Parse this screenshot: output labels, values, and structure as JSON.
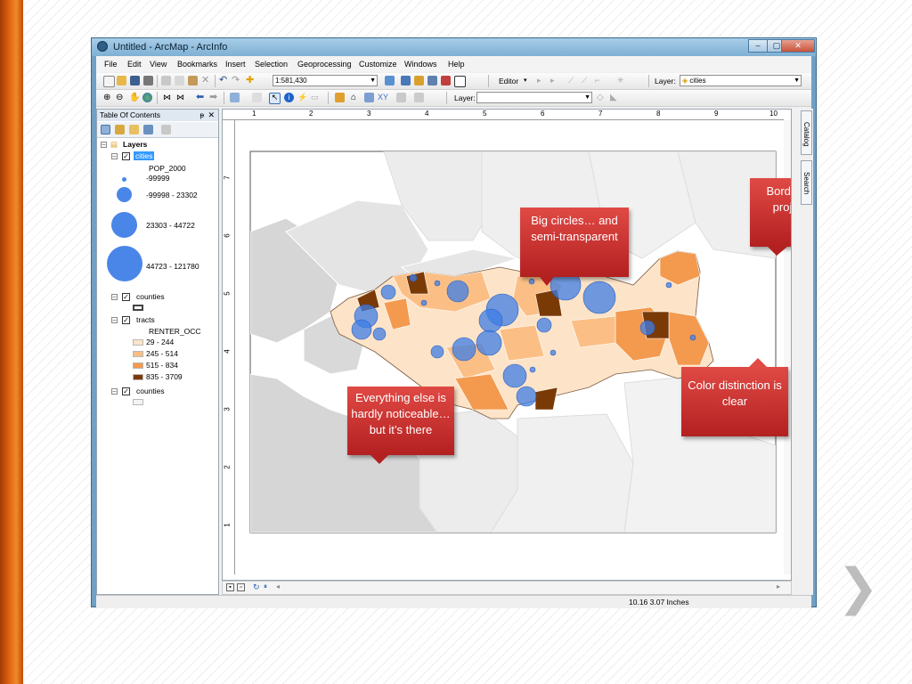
{
  "window": {
    "title": "Untitled - ArcMap - ArcInfo"
  },
  "menu": [
    "File",
    "Edit",
    "View",
    "Bookmarks",
    "Insert",
    "Selection",
    "Geoprocessing",
    "Customize",
    "Windows",
    "Help"
  ],
  "toolbar": {
    "scale": "1:581,430",
    "editor_label": "Editor",
    "layer_label": "Layer:",
    "layer_value": "cities",
    "layer2_label": "Layer:",
    "layer2_value": ""
  },
  "toc": {
    "title": "Table Of Contents",
    "root": "Layers",
    "cities": {
      "name": "cities",
      "field": "POP_2000",
      "classes": [
        "-99999",
        "-99998 - 23302",
        "23303 - 44722",
        "44723 - 121780"
      ]
    },
    "counties1": "counties",
    "tracts": {
      "name": "tracts",
      "field": "RENTER_OCC",
      "classes": [
        "29 - 244",
        "245 - 514",
        "515 - 834",
        "835 - 3709"
      ],
      "colors": [
        "#fde4c8",
        "#fbbf86",
        "#f39a4f",
        "#7a3a06"
      ]
    },
    "counties2": "counties"
  },
  "ruler": {
    "top": [
      "1",
      "2",
      "3",
      "4",
      "5",
      "6",
      "7",
      "8",
      "9",
      "10"
    ],
    "left": [
      "7",
      "6",
      "5",
      "4",
      "3",
      "2",
      "1"
    ]
  },
  "callouts": {
    "big_circles": "Big circles… and semi-transparent",
    "border": "Border around project area",
    "color": "Color distinction is clear",
    "everything": "Everything else is hardly noticeable… but it’s there"
  },
  "side_tabs": [
    "Catalog",
    "Search"
  ],
  "status": {
    "coords": "10.16  3.07 Inches"
  },
  "colors": {
    "callout": "#c62a26",
    "city": "#3e7ee6",
    "background_gray": "#dadada"
  }
}
